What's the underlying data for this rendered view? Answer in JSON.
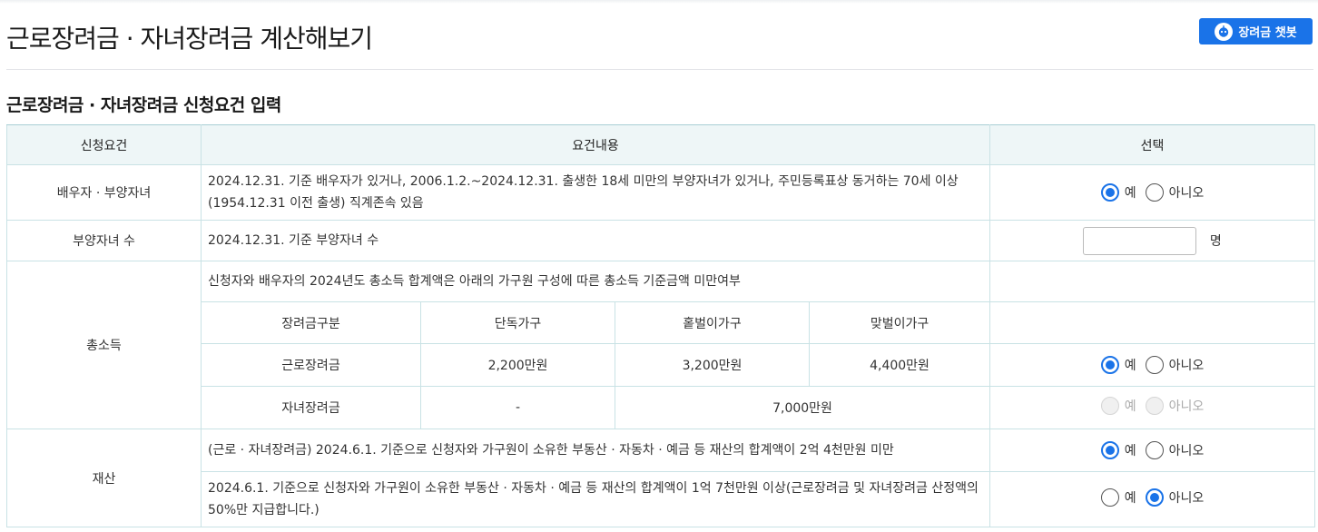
{
  "header": {
    "title": "근로장려금 · 자녀장려금 계산해보기",
    "chatbot_label": "장려금 챗봇"
  },
  "section": {
    "title": "근로장려금 · 자녀장려금 신청요건 입력"
  },
  "table": {
    "headers": [
      "신청요건",
      "요건내용",
      "선택"
    ],
    "rows": {
      "spouse": {
        "label": "배우자 · 부양자녀",
        "text": "2024.12.31. 기준 배우자가 있거나, 2006.1.2.~2024.12.31. 출생한 18세 미만의 부양자녀가 있거나, 주민등록표상 동거하는 70세 이상(1954.12.31 이전 출생) 직계존속 있음",
        "yes": "예",
        "no": "아니오",
        "selected": "yes"
      },
      "children": {
        "label": "부양자녀 수",
        "text": "2024.12.31. 기준 부양자녀 수",
        "input_value": "",
        "unit": "명"
      },
      "income": {
        "label": "총소득",
        "text": "신청자와 배우자의 2024년도 총소득 합계액은 아래의 가구원 구성에 따른 총소득 기준금액 미만여부",
        "sub_headers": [
          "장려금구분",
          "단독가구",
          "홑벌이가구",
          "맞벌이가구"
        ],
        "work": {
          "label": "근로장려금",
          "single": "2,200만원",
          "one_earner": "3,200만원",
          "dual_earner": "4,400만원",
          "yes": "예",
          "no": "아니오",
          "selected": "yes"
        },
        "child": {
          "label": "자녀장려금",
          "single": "-",
          "combined": "7,000만원",
          "yes": "예",
          "no": "아니오",
          "disabled": true
        }
      },
      "assets": {
        "label": "재산",
        "line1": {
          "text": "(근로 · 자녀장려금) 2024.6.1. 기준으로 신청자와 가구원이 소유한 부동산 · 자동차 · 예금 등 재산의 합계액이 2억 4천만원 미만",
          "yes": "예",
          "no": "아니오",
          "selected": "yes"
        },
        "line2": {
          "text": "2024.6.1. 기준으로 신청자와 가구원이 소유한 부동산 · 자동차 · 예금 등 재산의 합계액이 1억 7천만원 이상(근로장려금 및 자녀장려금 산정액의 50%만 지급합니다.)",
          "yes": "예",
          "no": "아니오",
          "selected": "no"
        }
      }
    }
  },
  "colors": {
    "accent": "#1a73e8",
    "header_bg": "#eef6f7",
    "border": "#c9e2e5"
  }
}
